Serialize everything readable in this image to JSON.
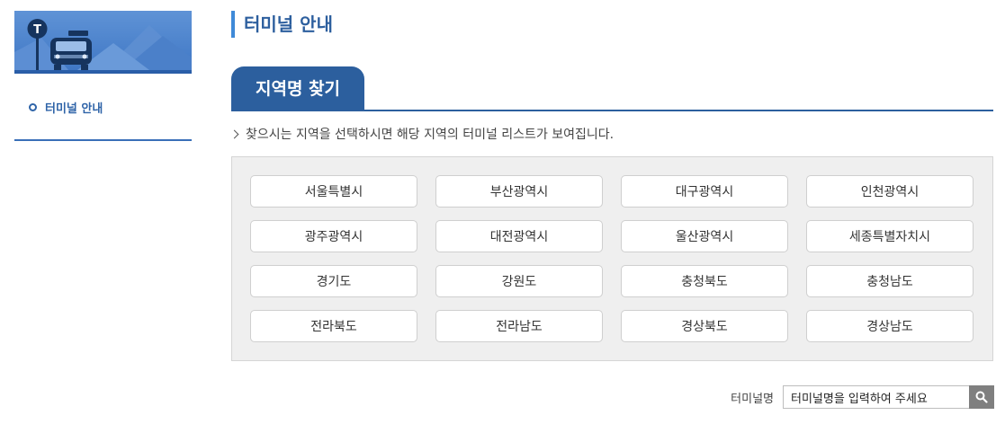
{
  "sidebar": {
    "menu_items": [
      {
        "label": "터미널 안내"
      }
    ]
  },
  "main": {
    "page_title": "터미널 안내",
    "tab_title": "지역명 찾기",
    "hint_text": "찾으시는 지역을 선택하시면 해당 지역의 터미널 리스트가 보여집니다.",
    "regions": [
      "서울특별시",
      "부산광역시",
      "대구광역시",
      "인천광역시",
      "광주광역시",
      "대전광역시",
      "울산광역시",
      "세종특별자치시",
      "경기도",
      "강원도",
      "충청북도",
      "충청남도",
      "전라북도",
      "전라남도",
      "경상북도",
      "경상남도"
    ]
  },
  "search": {
    "label": "터미널명",
    "value": "터미널명을 입력하여 주세요",
    "button_icon": "search-icon"
  },
  "colors": {
    "accent": "#2c5f9e",
    "title_bar": "#3f8ad8",
    "panel_bg": "#efefef",
    "search_button": "#7f7f7f"
  }
}
